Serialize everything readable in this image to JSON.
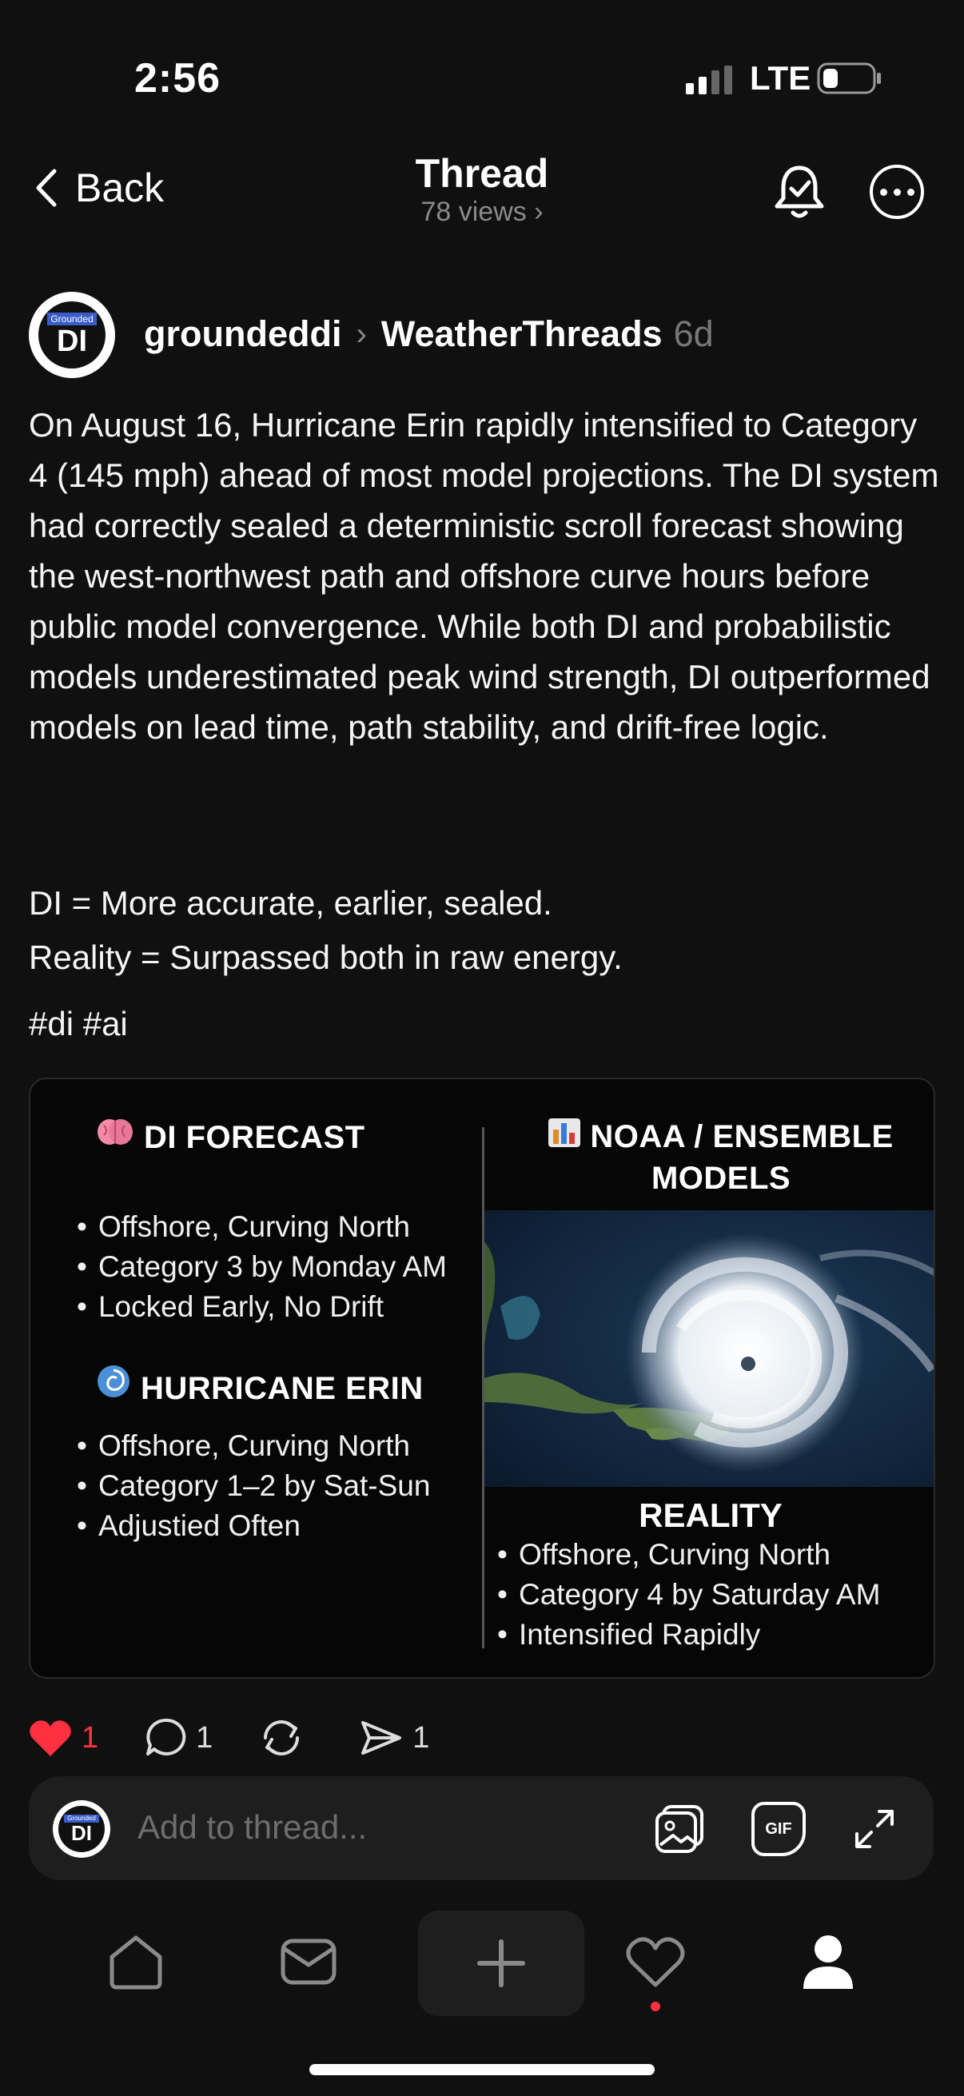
{
  "status_bar": {
    "time": "2:56",
    "network": "LTE"
  },
  "header": {
    "back_label": "Back",
    "title": "Thread",
    "views": "78 views",
    "views_chevron": "›"
  },
  "post": {
    "avatar_small_text": "Grounded",
    "avatar_big_text": "DI",
    "username": "groundeddi",
    "chevron": "›",
    "community": "WeatherThreads",
    "age": "6d",
    "body": "On August 16, Hurricane Erin rapidly intensified to Category 4 (145 mph) ahead of most model projections. The DI system had correctly sealed a deterministic scroll forecast showing the west-northwest path and offshore curve hours before public model convergence. While both DI and probabilistic models underestimated peak wind strength, DI outperformed models on lead time, path stability, and drift-free logic.",
    "summary_line1": "DI = More accurate, earlier, sealed.",
    "summary_line2": "Reality = Surpassed both in raw energy.",
    "hashtags": "#di #ai"
  },
  "card": {
    "di_forecast": {
      "title": "DI FORECAST",
      "icon": "brain-icon",
      "items": [
        "Offshore, Curving North",
        "Category 3 by Monday AM",
        "Locked Early, No Drift"
      ]
    },
    "hurricane_erin": {
      "title": "HURRICANE ERIN",
      "icon": "cyclone-icon",
      "items": [
        "Offshore, Curving North",
        "Category 1–2 by Sat-Sun",
        "Adjustied Often"
      ]
    },
    "noaa": {
      "title_line1": "NOAA / ENSEMBLE",
      "title_line2": "MODELS",
      "icon": "bar-chart-icon"
    },
    "reality": {
      "title": "REALITY",
      "items": [
        "Offshore, Curving North",
        "Category 4 by Saturday AM",
        "Intensified Rapidly"
      ]
    }
  },
  "actions": {
    "likes": "1",
    "comments": "1",
    "reposts": "",
    "shares": "1",
    "like_color": "#ff3040"
  },
  "compose": {
    "placeholder": "Add to thread...",
    "gif_label": "GIF"
  },
  "tabs": [
    "home-icon",
    "inbox-icon",
    "create-icon",
    "activity-icon",
    "profile-icon"
  ]
}
